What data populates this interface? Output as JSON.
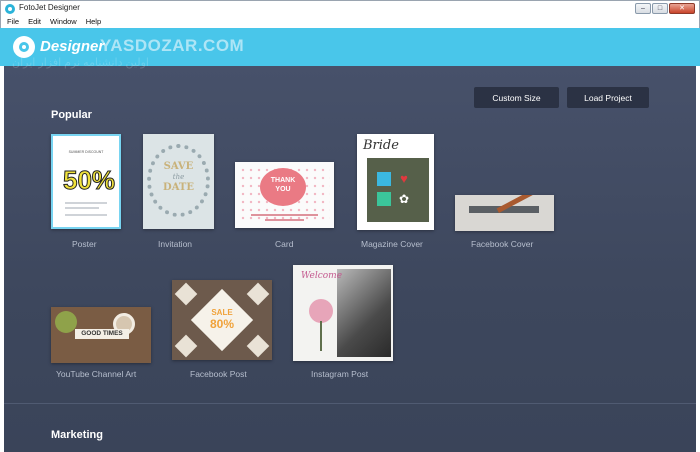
{
  "window": {
    "title": "FotoJet Designer",
    "minimize": "–",
    "maximize": "□",
    "close": "✕"
  },
  "menu": [
    "File",
    "Edit",
    "Window",
    "Help"
  ],
  "header": {
    "logo_text": "Designer",
    "watermark": "YASDOZAR.COM",
    "watermark_sub": "اولین دانشنامه نرم افزار ایران"
  },
  "actions": {
    "custom_size": "Custom Size",
    "load_project": "Load Project"
  },
  "sections": {
    "popular": "Popular",
    "marketing": "Marketing"
  },
  "templates": [
    {
      "label": "Poster"
    },
    {
      "label": "Invitation"
    },
    {
      "label": "Card"
    },
    {
      "label": "Magazine Cover"
    },
    {
      "label": "Facebook Cover"
    },
    {
      "label": "YouTube Channel Art"
    },
    {
      "label": "Facebook Post"
    },
    {
      "label": "Instagram Post"
    }
  ],
  "thumb_text": {
    "poster_head": "SUMMER DISCOUNT",
    "poster_big": "50%",
    "invite_line1": "SAVE",
    "invite_line2": "the",
    "invite_line3": "DATE",
    "card_line1": "THANK",
    "card_line2": "YOU",
    "mag_title": "Bride",
    "yt_text": "GOOD TIMES",
    "fbpost_sale": "SALE",
    "fbpost_pct": "80%",
    "ig_welcome": "Welcome"
  },
  "colors": {
    "header": "#49c6ea",
    "content_bg": "#424c63",
    "button_bg": "#2b3244",
    "label": "#b7bfce"
  }
}
